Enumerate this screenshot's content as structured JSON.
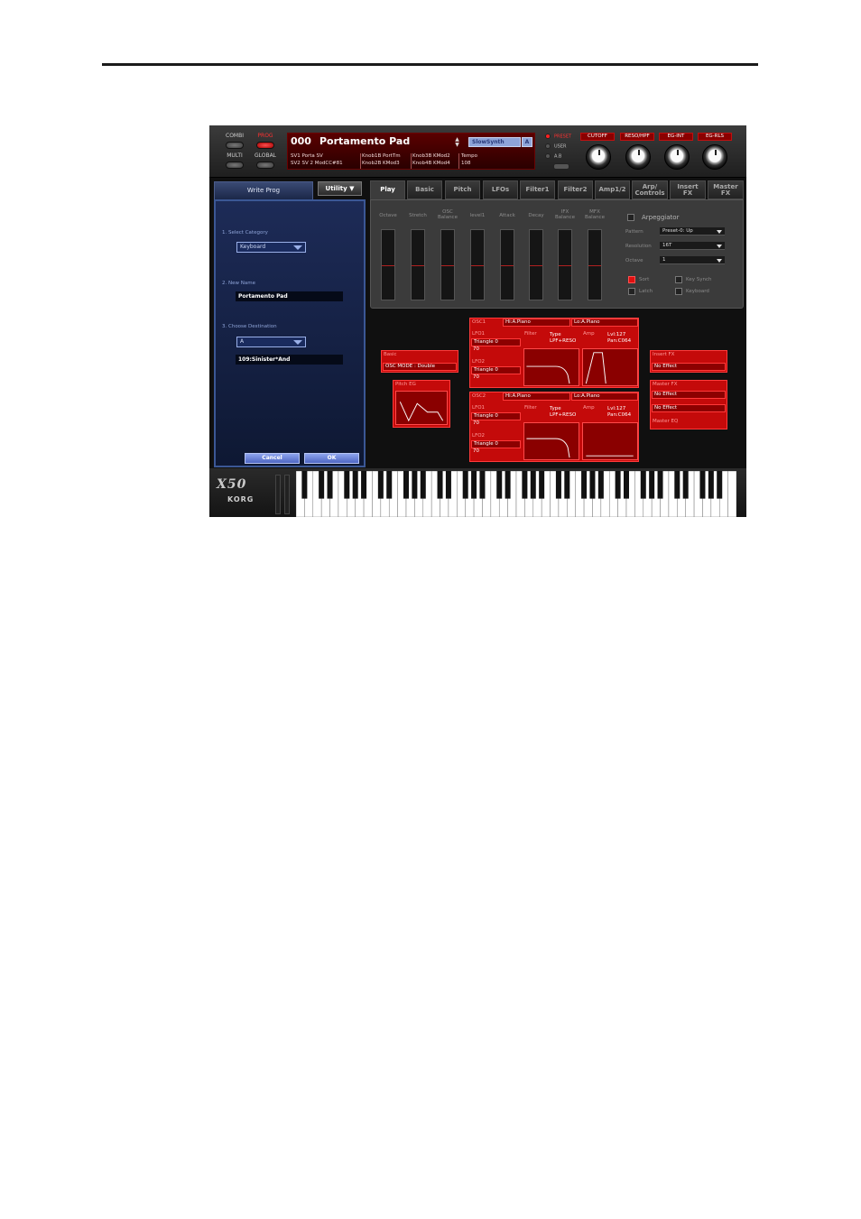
{
  "modes": [
    {
      "label": "COMBI",
      "active": false
    },
    {
      "label": "PROG",
      "active": true
    },
    {
      "label": "MULTI",
      "active": false
    },
    {
      "label": "GLOBAL",
      "active": false
    }
  ],
  "display": {
    "number": "000",
    "name": "Portamento Pad",
    "category": "SlowSynth",
    "bank": "A",
    "row1": [
      "SV1  Porta SV",
      "Knob1B  PortTm",
      "Knob3B KMod2",
      "Tempo"
    ],
    "row2": [
      "SV2 SV 2 ModCC#81",
      "Knob2B KMod3",
      "Knob4B KMod4",
      "108"
    ]
  },
  "banks": [
    {
      "label": "PRESET",
      "active": true
    },
    {
      "label": "USER",
      "active": false
    },
    {
      "label": "A.B",
      "active": false
    }
  ],
  "knobs": [
    "CUTOFF",
    "RESO/HPF",
    "EG-INT",
    "EG-RLS"
  ],
  "left_tab": "Write Prog",
  "utility_label": "Utility",
  "write_dialog": {
    "step1": "1. Select Category",
    "category": "Keyboard",
    "step2": "2. New Name",
    "new_name": "Portamento Pad",
    "step3": "3. Choose Destination",
    "dest_bank": "A",
    "dest_prog": "109:Sinister*And",
    "cancel": "Cancel",
    "ok": "OK"
  },
  "tabs": [
    {
      "label": "Play",
      "active": true
    },
    {
      "label": "Basic",
      "active": false
    },
    {
      "label": "Pitch",
      "active": false
    },
    {
      "label": "LFOs",
      "active": false
    },
    {
      "label": "Filter1",
      "active": false
    },
    {
      "label": "Filter2",
      "active": false
    },
    {
      "label": "Amp1/2",
      "active": false
    },
    {
      "label": "Arp/\nControls",
      "active": false
    },
    {
      "label": "Insert\nFX",
      "active": false
    },
    {
      "label": "Master\nFX",
      "active": false
    }
  ],
  "sliders": [
    "Octave",
    "Stretch",
    "OSC\nBalance",
    "level1",
    "Attack",
    "Decay",
    "IFX\nBalance",
    "MFX\nBalance"
  ],
  "arpeggiator": {
    "title": "Arpeggiator",
    "pattern_label": "Pattern",
    "pattern": "Preset-0: Up",
    "resolution_label": "Resolution",
    "resolution": "16T",
    "octave_label": "Octave",
    "octave": "1",
    "sort": "Sort",
    "latch": "Latch",
    "key_sync": "Key Synch",
    "keyboard": "Keyboard"
  },
  "edit": {
    "osc1": {
      "label": "OSC1",
      "hi": "Hi:A.Piano",
      "lo": "Lo:A.Piano",
      "lfo1": "LFO1",
      "lfo1_wave": "Triangle 0",
      "lfo1_val": "70",
      "lfo2": "LFO2",
      "lfo2_wave": "Triangle 0",
      "lfo2_val": "70",
      "filter": "Filter",
      "type": "Type",
      "type_val": "LPF+RESO",
      "amp": "Amp",
      "amp_lvl": "Lvl:127",
      "amp_pan": "Pan:C064"
    },
    "osc2": {
      "label": "OSC2",
      "hi": "Hi:A.Piano",
      "lo": "Lo:A.Piano",
      "lfo1": "LFO1",
      "lfo1_wave": "Triangle 0",
      "lfo1_val": "70",
      "lfo2": "LFO2",
      "lfo2_wave": "Triangle 0",
      "lfo2_val": "70",
      "filter": "Filter",
      "type": "Type",
      "type_val": "LPF+RESO",
      "amp": "Amp",
      "amp_lvl": "Lvl:127",
      "amp_pan": "Pan:C064"
    },
    "basic": {
      "label": "Basic",
      "value": "OSC MODE : Double"
    },
    "pitch_eg": "Pitch EG",
    "insert_fx": {
      "label": "Insert FX",
      "value": "No Effect"
    },
    "master_fx": {
      "label": "Master FX",
      "value1": "No Effect",
      "value2": "No Effect",
      "eq": "Master EQ"
    }
  },
  "brand": {
    "model": "X50",
    "maker": "KORG"
  }
}
